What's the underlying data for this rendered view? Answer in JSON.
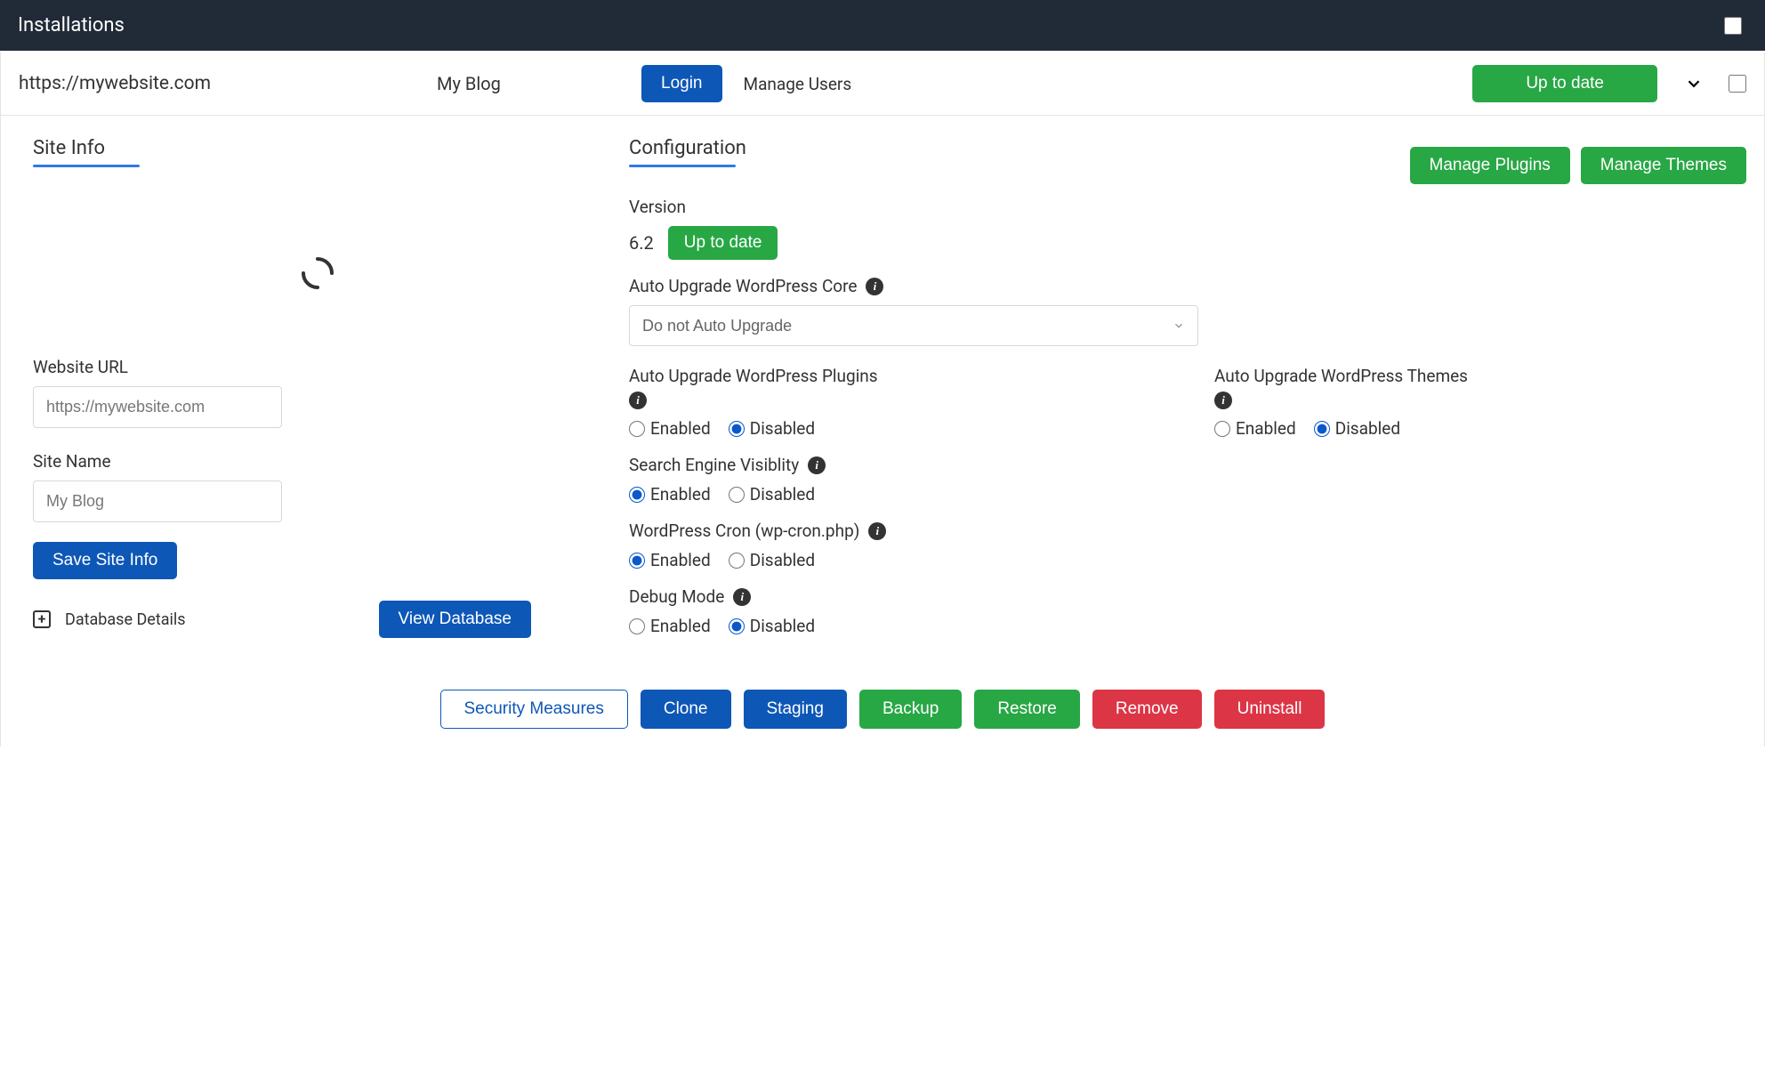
{
  "header": {
    "title": "Installations"
  },
  "installation": {
    "url": "https://mywebsite.com",
    "name": "My Blog",
    "login_label": "Login",
    "manage_users_label": "Manage Users",
    "status_label": "Up to date"
  },
  "site_info": {
    "title": "Site Info",
    "website_url_label": "Website URL",
    "website_url_value": "https://mywebsite.com",
    "site_name_label": "Site Name",
    "site_name_value": "My Blog",
    "save_label": "Save Site Info",
    "db_details_label": "Database Details",
    "view_db_label": "View Database"
  },
  "configuration": {
    "title": "Configuration",
    "manage_plugins_label": "Manage Plugins",
    "manage_themes_label": "Manage Themes",
    "version_label": "Version",
    "version_value": "6.2",
    "version_status": "Up to date",
    "auto_upgrade_core_label": "Auto Upgrade WordPress Core",
    "auto_upgrade_core_value": "Do not Auto Upgrade",
    "auto_upgrade_plugins_label": "Auto Upgrade WordPress Plugins",
    "auto_upgrade_themes_label": "Auto Upgrade WordPress Themes",
    "search_engine_label": "Search Engine Visiblity",
    "wp_cron_label": "WordPress Cron (wp-cron.php)",
    "debug_mode_label": "Debug Mode",
    "enabled_label": "Enabled",
    "disabled_label": "Disabled",
    "plugins_auto": "disabled",
    "themes_auto": "disabled",
    "search_engine": "enabled",
    "wp_cron": "enabled",
    "debug_mode": "disabled"
  },
  "footer": {
    "security_label": "Security Measures",
    "clone_label": "Clone",
    "staging_label": "Staging",
    "backup_label": "Backup",
    "restore_label": "Restore",
    "remove_label": "Remove",
    "uninstall_label": "Uninstall"
  }
}
